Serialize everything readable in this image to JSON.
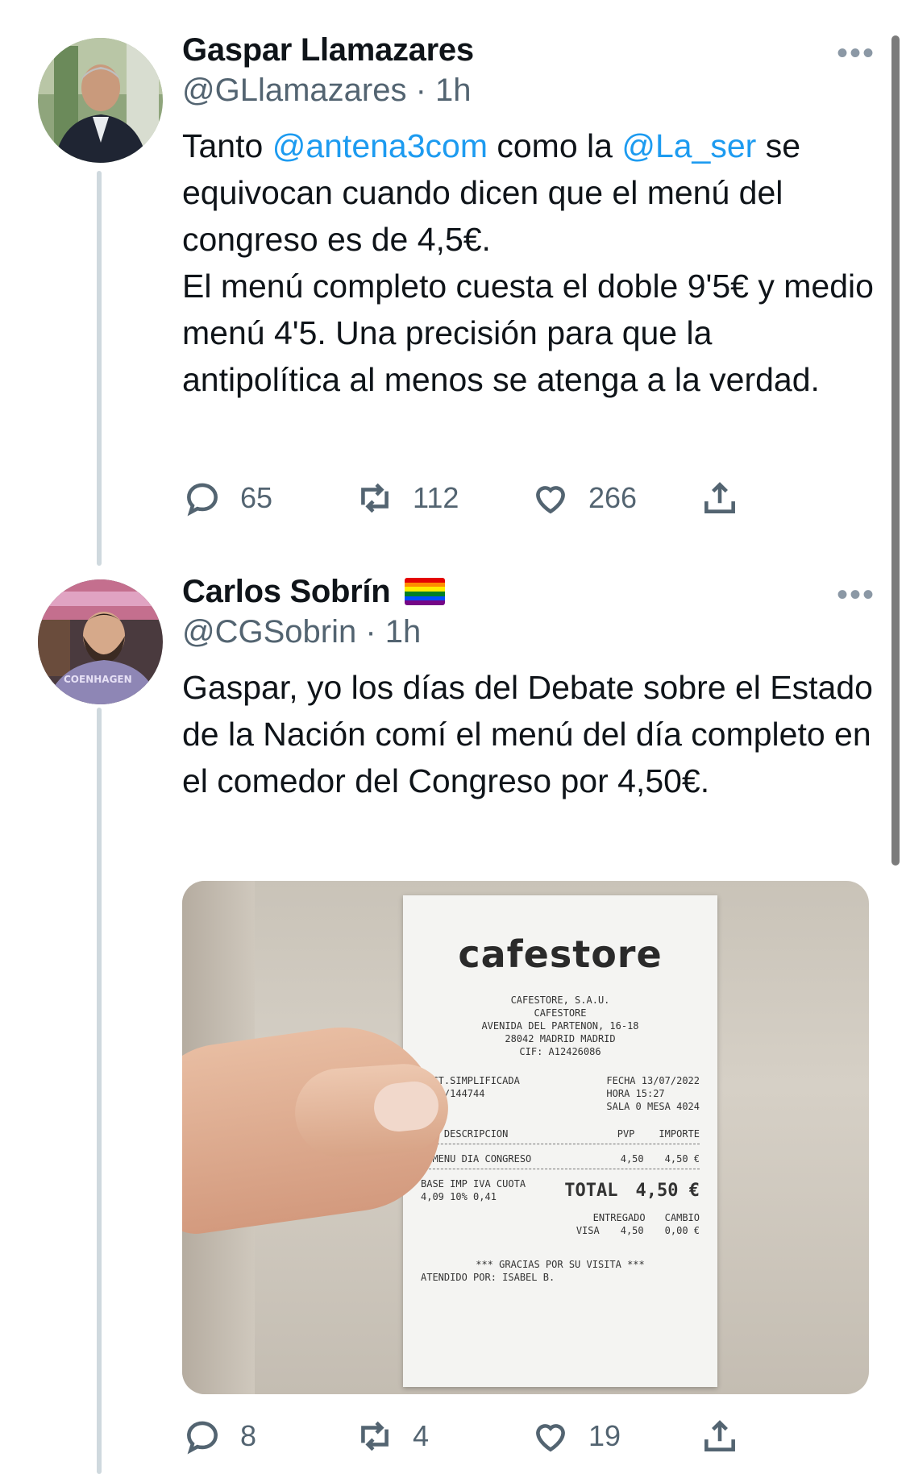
{
  "tweets": [
    {
      "display_name": "Gaspar Llamazares",
      "handle_time": "@GLlamazares · 1h",
      "more": "•••",
      "body_parts": {
        "p1": "Tanto ",
        "m1": "@antena3com",
        "p2": " como la ",
        "m2": "@La_ser",
        "p3": " se equivocan cuando dicen que el menú del congreso es de 4,5€.",
        "p4": "El menú completo cuesta el doble 9'5€ y medio menú 4'5. Una precisión para que la antipolítica al menos se atenga a la verdad."
      },
      "replies": "65",
      "retweets": "112",
      "likes": "266"
    },
    {
      "display_name": "Carlos Sobrín",
      "handle_time": "@CGSobrin · 1h",
      "more": "•••",
      "body": "Gaspar, yo los días del Debate sobre el Estado de la Nación comí el menú del día completo en el comedor del Congreso por 4,50€.",
      "replies": "8",
      "retweets": "4",
      "likes": "19",
      "receipt": {
        "brand": "cafestore",
        "company": "CAFESTORE, S.A.U.",
        "store": "CAFESTORE",
        "address": "AVENIDA DEL PARTENON, 16-18",
        "city": "28042 MADRID   MADRID",
        "cif": "CIF: A12426086",
        "invoice": "FACT.SIMPLIFICADA",
        "invoice_no": "T003/144744",
        "date": "FECHA 13/07/2022",
        "time": "HORA  15:27",
        "table": "SALA 0 MESA 4024",
        "col_desc": "UDS DESCRIPCION",
        "col_pvp": "PVP",
        "col_importe": "IMPORTE",
        "item": "1  MENU DIA CONGRESO",
        "item_pvp": "4,50",
        "item_importe": "4,50 €",
        "tax_header": "BASE  IMP IVA  CUOTA",
        "tax_values": "4,09  10%   0,41",
        "total_label": "TOTAL",
        "total_value": "4,50 €",
        "paid_label": "ENTREGADO",
        "change_label": "CAMBIO",
        "paid_method": "VISA",
        "paid_value": "4,50",
        "change_value": "0,00 €",
        "thanks": "*** GRACIAS POR SU VISITA ***",
        "attended": "ATENDIDO POR: ISABEL B."
      }
    }
  ]
}
